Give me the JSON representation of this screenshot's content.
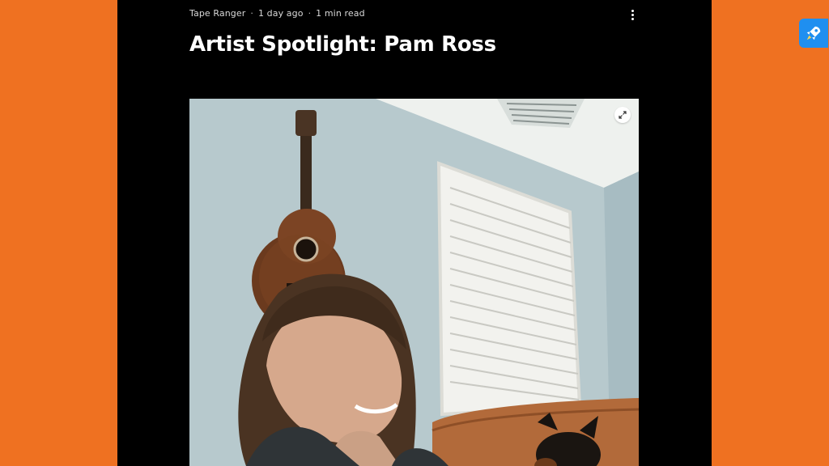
{
  "post": {
    "author": "Tape Ranger",
    "separator": "·",
    "published": "1 day ago",
    "read_time": "1 min read",
    "title": "Artist Spotlight: Pam Ross",
    "more_icon": "more-vertical-icon",
    "expand_icon": "expand-icon"
  },
  "launcher": {
    "icon": "rocket-icon",
    "color": "#1f8ff0"
  },
  "colors": {
    "page_bg": "#ef7121",
    "post_bg": "#000000",
    "title": "#ffffff"
  }
}
